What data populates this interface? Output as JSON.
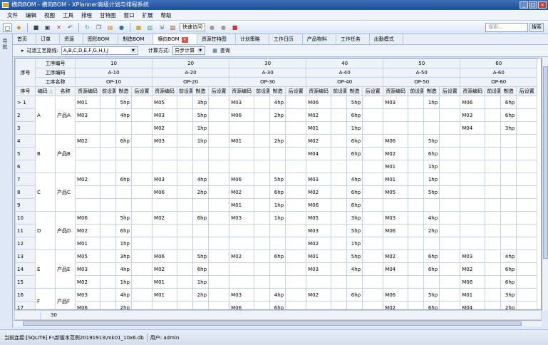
{
  "window": {
    "title": "横向BOM - 横向BOM - XPlanner高级计划与排程系统"
  },
  "menu": [
    "文件",
    "编辑",
    "视图",
    "工具",
    "排程",
    "甘特图",
    "窗口",
    "扩展",
    "帮助"
  ],
  "toolbar": {
    "quick_access": "快速访问",
    "search_placeholder": "搜索...",
    "search_button": "搜索"
  },
  "left_strip": {
    "label": "导航"
  },
  "tabs": [
    "首页",
    "订单",
    "资源",
    "图形BOM",
    "制造BOM",
    "横向BOM",
    "资源甘特图",
    "计划策略",
    "工作日历",
    "产品物料",
    "工作任务",
    "出勤模式"
  ],
  "active_tab": "横向BOM",
  "filter": {
    "route_label": "过滤工艺路线:",
    "route_value": "A,B,C,D,E,F,G,H,I,J",
    "calc_label": "计算方式:",
    "calc_value": "异步计算",
    "query_label": "查询"
  },
  "grid": {
    "row_header": "序号",
    "group_labels": [
      "工序编号",
      "工序编码",
      "工序名称"
    ],
    "col_headers": [
      "序号",
      "编码",
      "名称"
    ],
    "sort_icon": "sort-asc-icon",
    "sub_headers": [
      "资源编码",
      "前设置",
      "制造",
      "后设置"
    ],
    "processes": [
      {
        "no": "10",
        "code": "A-10",
        "name": "OP-10"
      },
      {
        "no": "20",
        "code": "A-20",
        "name": "OP-20"
      },
      {
        "no": "30",
        "code": "A-30",
        "name": "OP-30"
      },
      {
        "no": "40",
        "code": "A-40",
        "name": "OP-40"
      },
      {
        "no": "50",
        "code": "A-50",
        "name": "OP-50"
      },
      {
        "no": "60",
        "code": "A-60",
        "name": "OP-60"
      }
    ],
    "rows": [
      {
        "seq": "1",
        "cells": [
          [
            "M01",
            "",
            "5hp",
            ""
          ],
          [
            "M05",
            "",
            "3hp",
            ""
          ],
          [
            "M03",
            "",
            "4hp",
            ""
          ],
          [
            "M06",
            "",
            "5hp",
            ""
          ],
          [
            "M03",
            "",
            "1hp",
            ""
          ],
          [
            "M06",
            "",
            "6hp",
            ""
          ]
        ]
      },
      {
        "seq": "2",
        "cells": [
          [
            "M03",
            "",
            "4hp",
            ""
          ],
          [
            "M03",
            "",
            "5hp",
            ""
          ],
          [
            "M06",
            "",
            "2hp",
            ""
          ],
          [
            "M02",
            "",
            "6hp",
            ""
          ],
          [
            "",
            "",
            "",
            ""
          ],
          [
            "M03",
            "",
            "6hp",
            ""
          ]
        ]
      },
      {
        "seq": "3",
        "cells": [
          [
            "",
            "",
            "",
            ""
          ],
          [
            "M02",
            "",
            "1hp",
            ""
          ],
          [
            "",
            "",
            "",
            ""
          ],
          [
            "M01",
            "",
            "1hp",
            ""
          ],
          [
            "",
            "",
            "",
            ""
          ],
          [
            "M04",
            "",
            "3hp",
            ""
          ]
        ]
      },
      {
        "seq": "4",
        "cells": [
          [
            "M02",
            "",
            "6hp",
            ""
          ],
          [
            "M03",
            "",
            "1hp",
            ""
          ],
          [
            "M01",
            "",
            "2hp",
            ""
          ],
          [
            "M02",
            "",
            "6hp",
            ""
          ],
          [
            "M06",
            "",
            "5hp",
            ""
          ],
          [
            "",
            "",
            "",
            ""
          ]
        ]
      },
      {
        "seq": "5",
        "cells": [
          [
            "",
            "",
            "",
            ""
          ],
          [
            "",
            "",
            "",
            ""
          ],
          [
            "",
            "",
            "",
            ""
          ],
          [
            "M04",
            "",
            "6hp",
            ""
          ],
          [
            "M02",
            "",
            "6hp",
            ""
          ],
          [
            "",
            "",
            "",
            ""
          ]
        ]
      },
      {
        "seq": "6",
        "cells": [
          [
            "",
            "",
            "",
            ""
          ],
          [
            "",
            "",
            "",
            ""
          ],
          [
            "",
            "",
            "",
            ""
          ],
          [
            "",
            "",
            "",
            ""
          ],
          [
            "M01",
            "",
            "1hp",
            ""
          ],
          [
            "",
            "",
            "",
            ""
          ]
        ]
      },
      {
        "seq": "7",
        "cells": [
          [
            "M02",
            "",
            "6hp",
            ""
          ],
          [
            "M03",
            "",
            "4hp",
            ""
          ],
          [
            "M06",
            "",
            "5hp",
            ""
          ],
          [
            "M03",
            "",
            "4hp",
            ""
          ],
          [
            "M01",
            "",
            "1hp",
            ""
          ],
          [
            "",
            "",
            "",
            ""
          ]
        ]
      },
      {
        "seq": "8",
        "cells": [
          [
            "",
            "",
            "",
            ""
          ],
          [
            "M06",
            "",
            "2hp",
            ""
          ],
          [
            "M02",
            "",
            "6hp",
            ""
          ],
          [
            "M02",
            "",
            "6hp",
            ""
          ],
          [
            "M05",
            "",
            "5hp",
            ""
          ],
          [
            "",
            "",
            "",
            ""
          ]
        ]
      },
      {
        "seq": "9",
        "cells": [
          [
            "",
            "",
            "",
            ""
          ],
          [
            "",
            "",
            "",
            ""
          ],
          [
            "M01",
            "",
            "1hp",
            ""
          ],
          [
            "M06",
            "",
            "6hp",
            ""
          ],
          [
            "",
            "",
            "",
            ""
          ],
          [
            "",
            "",
            "",
            ""
          ]
        ]
      },
      {
        "seq": "10",
        "cells": [
          [
            "M06",
            "",
            "5hp",
            ""
          ],
          [
            "M02",
            "",
            "6hp",
            ""
          ],
          [
            "M03",
            "",
            "1hp",
            ""
          ],
          [
            "M05",
            "",
            "3hp",
            ""
          ],
          [
            "M03",
            "",
            "4hp",
            ""
          ],
          [
            "",
            "",
            "",
            ""
          ]
        ]
      },
      {
        "seq": "11",
        "cells": [
          [
            "M02",
            "",
            "6hp",
            ""
          ],
          [
            "",
            "",
            "",
            ""
          ],
          [
            "",
            "",
            "",
            ""
          ],
          [
            "M03",
            "",
            "5hp",
            ""
          ],
          [
            "M06",
            "",
            "2hp",
            ""
          ],
          [
            "",
            "",
            "",
            ""
          ]
        ]
      },
      {
        "seq": "12",
        "cells": [
          [
            "M01",
            "",
            "1hp",
            ""
          ],
          [
            "",
            "",
            "",
            ""
          ],
          [
            "",
            "",
            "",
            ""
          ],
          [
            "M02",
            "",
            "1hp",
            ""
          ],
          [
            "",
            "",
            "",
            ""
          ],
          [
            "",
            "",
            "",
            ""
          ]
        ]
      },
      {
        "seq": "13",
        "cells": [
          [
            "M05",
            "",
            "3hp",
            ""
          ],
          [
            "M06",
            "",
            "5hp",
            ""
          ],
          [
            "M02",
            "",
            "6hp",
            ""
          ],
          [
            "M01",
            "",
            "5hp",
            ""
          ],
          [
            "M02",
            "",
            "6hp",
            ""
          ],
          [
            "M03",
            "",
            "4hp",
            ""
          ]
        ]
      },
      {
        "seq": "14",
        "cells": [
          [
            "M03",
            "",
            "4hp",
            ""
          ],
          [
            "M02",
            "",
            "6hp",
            ""
          ],
          [
            "",
            "",
            "",
            ""
          ],
          [
            "M03",
            "",
            "4hp",
            ""
          ],
          [
            "M04",
            "",
            "6hp",
            ""
          ],
          [
            "M02",
            "",
            "6hp",
            ""
          ]
        ]
      },
      {
        "seq": "15",
        "cells": [
          [
            "M02",
            "",
            "1hp",
            ""
          ],
          [
            "M01",
            "",
            "1hp",
            ""
          ],
          [
            "",
            "",
            "",
            ""
          ],
          [
            "",
            "",
            "",
            ""
          ],
          [
            "",
            "",
            "",
            ""
          ],
          [
            "M06",
            "",
            "6hp",
            ""
          ]
        ]
      },
      {
        "seq": "16",
        "cells": [
          [
            "M03",
            "",
            "4hp",
            ""
          ],
          [
            "M01",
            "",
            "2hp",
            ""
          ],
          [
            "M03",
            "",
            "4hp",
            ""
          ],
          [
            "M02",
            "",
            "6hp",
            ""
          ],
          [
            "M06",
            "",
            "5hp",
            ""
          ],
          [
            "M01",
            "",
            "3hp",
            ""
          ]
        ]
      },
      {
        "seq": "17",
        "cells": [
          [
            "M06",
            "",
            "2hp",
            ""
          ],
          [
            "",
            "",
            "",
            ""
          ],
          [
            "M06",
            "",
            "6hp",
            ""
          ],
          [
            "",
            "",
            "",
            ""
          ],
          [
            "M02",
            "",
            "6hp",
            ""
          ],
          [
            "M04",
            "",
            "2hp",
            ""
          ]
        ]
      }
    ],
    "groups": [
      {
        "code": "A",
        "name": "产品A",
        "start": 0,
        "span": 3
      },
      {
        "code": "B",
        "name": "产品B",
        "start": 3,
        "span": 3
      },
      {
        "code": "C",
        "name": "产品C",
        "start": 6,
        "span": 3
      },
      {
        "code": "D",
        "name": "产品D",
        "start": 9,
        "span": 3
      },
      {
        "code": "E",
        "name": "产品E",
        "start": 12,
        "span": 3
      },
      {
        "code": "F",
        "name": "产品F",
        "start": 15,
        "span": 2
      }
    ],
    "row_count": "30"
  },
  "status": {
    "connection": "当前连接:[SQLITE] F:\\新版本范例20191913\\mk01_10x6.db",
    "user": "用户: admin"
  }
}
